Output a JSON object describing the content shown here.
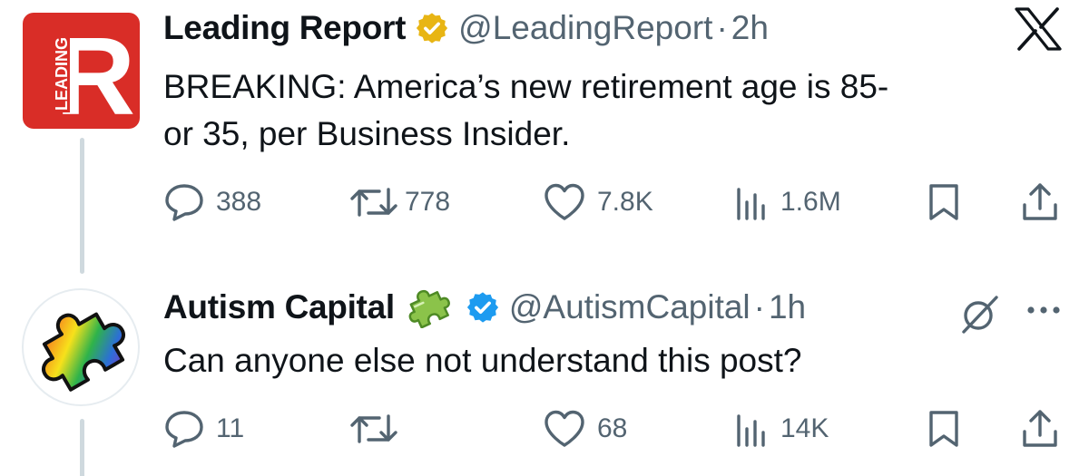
{
  "tweets": [
    {
      "name": "Leading Report",
      "handle": "@LeadingReport",
      "separator": "·",
      "time": "2h",
      "avatar_letter": "R",
      "avatar_text": "LEADING",
      "text_lines": [
        "BREAKING: America’s new retirement age is 85-",
        "or 35, per Business Insider."
      ],
      "replies": "388",
      "reposts": "778",
      "likes": "7.8K",
      "views": "1.6M",
      "badge": "gold-verified-icon"
    },
    {
      "name": "Autism Capital",
      "handle": "@AutismCapital",
      "separator": "·",
      "time": "1h",
      "text_lines": [
        "Can anyone else not understand this post?"
      ],
      "replies": "11",
      "reposts": "",
      "likes": "68",
      "views": "14K",
      "badge": "blue-verified-icon"
    }
  ],
  "colors": {
    "text": "#0f1419",
    "muted": "#536471",
    "thread_line": "#cfd9de",
    "leading_red": "#d92d27",
    "gold_badge": "#e8b514",
    "blue_badge": "#1d9bf0"
  },
  "icons": {
    "brand": "x-logo-icon",
    "menu": "more-icon",
    "grok": "grok-icon",
    "reply": "reply-icon",
    "repost": "repost-icon",
    "like": "like-icon",
    "views": "views-icon",
    "bookmark": "bookmark-icon",
    "share": "share-icon",
    "emoji": "puzzle-piece-emoji"
  }
}
